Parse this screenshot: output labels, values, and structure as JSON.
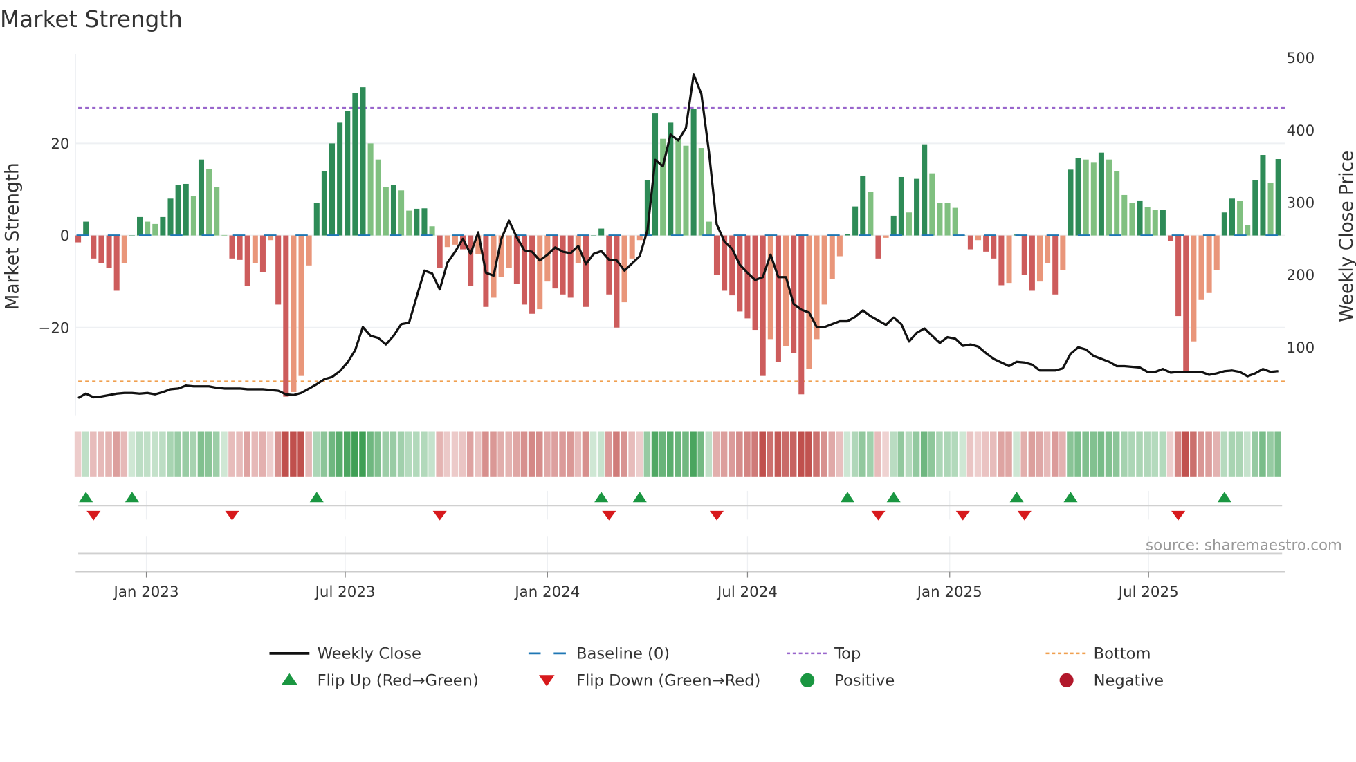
{
  "chart_data": {
    "type": "bar",
    "title": "Market Strength",
    "ylabel": "Market Strength",
    "y2label": "Weekly Close Price",
    "ylim": [
      -39,
      38
    ],
    "y2lim": [
      0,
      500
    ],
    "start_date": "2022-10-31",
    "frequency": "weekly",
    "yticks": [
      {
        "v": 20,
        "label": "20"
      },
      {
        "v": 0,
        "label": "0"
      },
      {
        "v": -20,
        "label": "−20"
      }
    ],
    "y2ticks": [
      {
        "v": 500,
        "label": "500"
      },
      {
        "v": 400,
        "label": "400"
      },
      {
        "v": 300,
        "label": "300"
      },
      {
        "v": 200,
        "label": "200"
      },
      {
        "v": 100,
        "label": "100"
      }
    ],
    "xticks": [
      {
        "date": "2023-01-01",
        "label": "Jan 2023"
      },
      {
        "date": "2023-07-01",
        "label": "Jul 2023"
      },
      {
        "date": "2024-01-01",
        "label": "Jan 2024"
      },
      {
        "date": "2024-07-01",
        "label": "Jul 2024"
      },
      {
        "date": "2025-01-01",
        "label": "Jan 2025"
      },
      {
        "date": "2025-07-01",
        "label": "Jul 2025"
      }
    ],
    "top_level": 27.7,
    "bottom_level": -31.7,
    "strength": [
      -1.5,
      3,
      -5,
      -6,
      -7,
      -12,
      -6,
      0,
      4,
      3,
      2.5,
      4,
      8,
      11,
      11.2,
      8.5,
      16.5,
      14.5,
      10.5,
      0.1,
      -5,
      -5.3,
      -11,
      -6,
      -8,
      -1,
      -15,
      -35,
      -34,
      -30.5,
      -6.5,
      7,
      14,
      20,
      24.5,
      27,
      31,
      32.2,
      20,
      16.5,
      10.5,
      11,
      9.8,
      5.4,
      5.8,
      5.9,
      2,
      -7,
      -2.5,
      -2,
      -3,
      -11,
      -4,
      -15.5,
      -13.5,
      -9,
      -7,
      -10.5,
      -15,
      -17,
      -16,
      -10,
      -11.5,
      -12.8,
      -13.5,
      -6,
      -15.5,
      0,
      1.5,
      -12.8,
      -20,
      -14.5,
      -5,
      -1,
      12,
      26.5,
      21,
      24.5,
      21,
      19.5,
      27.5,
      19,
      3,
      -8.5,
      -12,
      -13,
      -16.5,
      -18,
      -20.5,
      -30.5,
      -22.5,
      -27.5,
      -24,
      -25.5,
      -34.5,
      -29,
      -22.5,
      -15,
      -9.5,
      -4.5,
      0.3,
      6.3,
      13,
      9.5,
      -5,
      -0.5,
      4.3,
      12.7,
      5,
      12.3,
      19.8,
      13.5,
      7.1,
      7,
      6,
      0,
      -3,
      -1,
      -3.5,
      -5,
      -10.8,
      -10.3,
      0.2,
      -8.5,
      -12,
      -10,
      -6,
      -12.8,
      -7.5,
      14.3,
      16.8,
      16.5,
      15.8,
      18,
      16.5,
      14,
      8.8,
      7,
      7.6,
      6.2,
      5.5,
      5.5,
      -1.2,
      -17.5,
      -29.5,
      -23,
      -14,
      -12.5,
      -7.5,
      5,
      8,
      7.5,
      2.2,
      12,
      17.5,
      11.5,
      16.6
    ],
    "close": [
      30,
      36,
      31,
      32,
      34,
      36,
      37,
      37,
      36,
      37,
      35,
      38,
      42,
      43,
      47,
      46,
      46,
      46,
      44,
      43,
      43,
      43,
      42,
      42,
      42,
      41,
      40,
      35,
      34,
      37,
      43,
      49,
      56,
      59,
      67,
      79,
      96,
      128,
      116,
      113,
      104,
      116,
      132,
      134,
      170,
      206,
      202,
      180,
      217,
      232,
      250,
      229,
      259,
      203,
      199,
      250,
      275,
      252,
      234,
      232,
      220,
      228,
      238,
      232,
      230,
      240,
      215,
      229,
      233,
      221,
      220,
      206,
      216,
      226,
      262,
      359,
      350,
      394,
      386,
      403,
      477,
      450,
      369,
      270,
      246,
      236,
      214,
      203,
      193,
      197,
      228,
      197,
      197,
      160,
      152,
      148,
      128,
      128,
      132,
      136,
      136,
      142,
      151,
      143,
      137,
      131,
      141,
      132,
      108,
      120,
      126,
      116,
      106,
      114,
      112,
      102,
      104,
      101,
      92,
      84,
      79,
      74,
      80,
      79,
      76,
      68,
      68,
      68,
      71,
      91,
      100,
      97,
      88,
      84,
      80,
      74,
      74,
      73,
      72,
      66,
      66,
      70,
      65,
      66,
      66,
      66,
      66,
      62,
      64,
      67,
      68,
      66,
      60,
      64,
      70,
      66,
      67
    ],
    "flip_up_weeks": [
      1,
      7,
      31,
      68,
      73,
      100,
      106,
      122,
      129,
      149
    ],
    "flip_down_weeks": [
      2,
      20,
      47,
      69,
      83,
      104,
      115,
      123,
      143
    ],
    "colors": {
      "pos_strong": "#2e8b57",
      "pos_weak": "#80c080",
      "neg_strong": "#cd5c5c",
      "neg_weak": "#e9967a",
      "close": "#111111",
      "baseline": "#1f77b4",
      "top": "#9966cc",
      "bottom": "#f0a050",
      "flip_up": "#1a9641",
      "flip_down": "#d7191c",
      "positive": "#1a9641",
      "negative": "#b2182b"
    },
    "legend": [
      {
        "label": "Weekly Close",
        "kind": "line"
      },
      {
        "label": "Baseline (0)",
        "kind": "dash"
      },
      {
        "label": "Top",
        "kind": "dotted-top"
      },
      {
        "label": "Bottom",
        "kind": "dotted-bottom"
      },
      {
        "label": "Flip Up (Red→Green)",
        "kind": "tri-up"
      },
      {
        "label": "Flip Down (Green→Red)",
        "kind": "tri-down"
      },
      {
        "label": "Positive",
        "kind": "dot-pos"
      },
      {
        "label": "Negative",
        "kind": "dot-neg"
      }
    ],
    "legend_position": "bottom",
    "source": "source: sharemaestro.com"
  }
}
